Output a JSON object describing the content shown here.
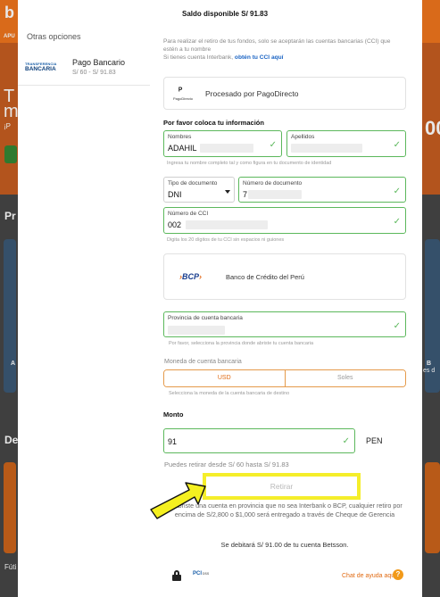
{
  "background": {
    "brand_letter": "b",
    "nav_label": "APU",
    "hero_line1": "T",
    "hero_line2": "m",
    "hero_line3": "¡P",
    "section_pr": "Pr",
    "section_de": "De",
    "right_number": "00",
    "card_label_a": "A",
    "card_label_b": "B",
    "right_card_text": "es d",
    "footer_left": "Fúti"
  },
  "modal": {
    "balance": "Saldo disponible S/ 91.83",
    "other_options": "Otras opciones",
    "method": {
      "logo_top": "TRANSFERENCIA",
      "logo_bottom": "BANCARIA",
      "name": "Pago Bancario",
      "range": "S/ 60 - S/ 91.83"
    },
    "info": {
      "line1": "Para realizar el retiro de tus fondos, solo se aceptarán las cuentas bancarias (CCI) que estén a tu nombre",
      "line2_prefix": "Si tienes cuenta Interbank,",
      "line2_link": "obtén tu CCI aquí"
    },
    "processor": {
      "logo_text": "PagoDirecto",
      "label": "Procesado por PagoDirecto"
    },
    "form_title": "Por favor coloca tu información",
    "names": {
      "first_label": "Nombres",
      "first_value": "ADAHIL",
      "last_label": "Apellidos",
      "hint": "Ingresa tu nombre completo tal y como figura en tu documento de identidad"
    },
    "document": {
      "type_label": "Tipo de documento",
      "type_value": "DNI",
      "number_label": "Número de documento",
      "number_value": "7"
    },
    "cci": {
      "label": "Número de CCI",
      "value": "002",
      "hint": "Digita los 20 dígitos de tu CCI sin espacios ni guiones"
    },
    "bank": {
      "logo": "BCP",
      "name": "Banco de Crédito del Perú"
    },
    "province": {
      "label": "Provincia de cuenta bancaria",
      "hint": "Por favor, selecciona la provincia donde abriste tu cuenta bancaria"
    },
    "currency": {
      "label": "Moneda de cuenta bancaria",
      "options": [
        "USD",
        "Soles"
      ],
      "selected": "USD",
      "hint": "Selecciona la moneda de la cuenta bancaria de destino"
    },
    "amount": {
      "title": "Monto",
      "value": "91",
      "currency": "PEN",
      "limits": "Puedes retirar desde S/ 60 hasta S/ 91.83"
    },
    "withdraw_label": "Retirar",
    "notice": "Si abriste una cuenta en provincia que no sea Interbank o BCP, cualquier retiro por encima de S/2,800 o $1,000 será entregado a través de Cheque de Gerencia",
    "debit": "Se debitará S/ 91.00 de tu cuenta Betsson.",
    "footer": {
      "pci_label": "PCI",
      "pci_sub": "DSS",
      "help": "Chat de ayuda aquí",
      "help_icon": "?"
    }
  },
  "colors": {
    "accent_orange": "#e06a12",
    "success_green": "#5cb85c",
    "highlight_yellow": "#f5ee2a",
    "link_blue": "#1b64c4"
  }
}
